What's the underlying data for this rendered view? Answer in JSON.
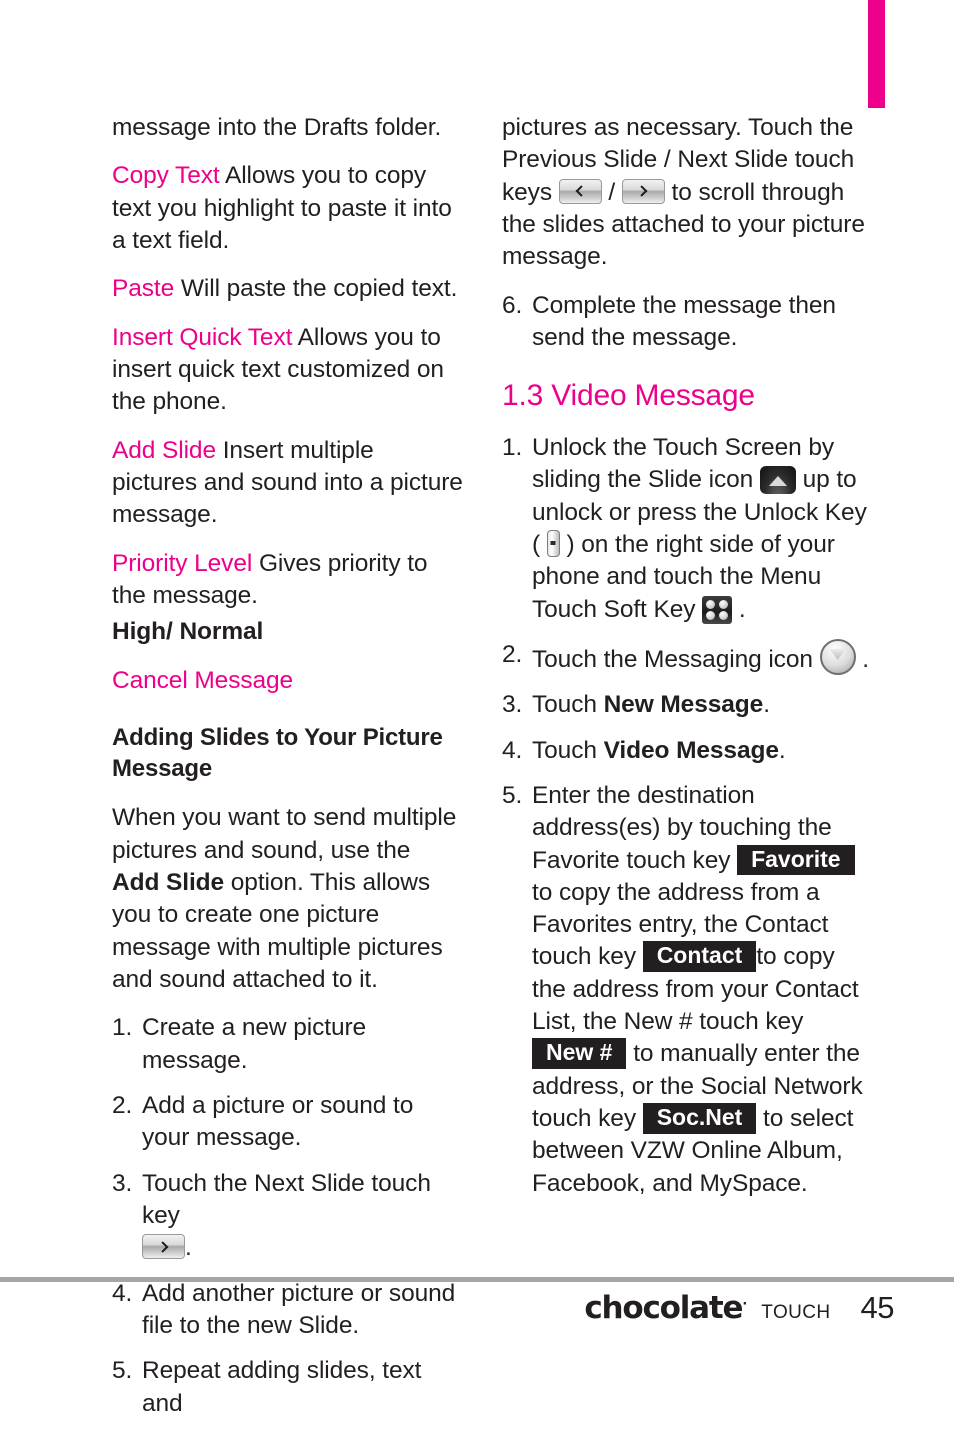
{
  "theme": {
    "accent_pink": "#ec008c",
    "text": "#231f20",
    "key_black": "#231f20",
    "rule_gray": "#a6a6a6"
  },
  "edge_tab": {
    "name": "chapter-tab",
    "color": "#ec008c"
  },
  "left_column": {
    "continued_paragraph": "message into the Drafts folder.",
    "options": [
      {
        "term": "Copy Text",
        "desc": "Allows you to copy text you highlight to paste it into a text field."
      },
      {
        "term": "Paste",
        "desc": "Will paste the copied text."
      },
      {
        "term": "Insert Quick Text",
        "desc": "Allows you to insert quick text customized on the phone."
      },
      {
        "term": "Add Slide",
        "desc": "Insert multiple pictures and sound into a picture message."
      },
      {
        "term": "Priority Level",
        "desc": "Gives priority to the message."
      }
    ],
    "priority_values": "High/ Normal",
    "cancel_option": "Cancel Message",
    "subheading": "Adding Slides to Your Picture Message",
    "intro": {
      "part1": "When you want to send multiple pictures and sound, use the ",
      "bold1": "Add Slide",
      "part2": " option. This allows you to create one picture message with multiple pictures and sound attached to it."
    },
    "steps": [
      {
        "num": "1.",
        "text": "Create a new picture message."
      },
      {
        "num": "2.",
        "text": "Add a picture or sound to your message."
      },
      {
        "num": "3.",
        "text_before": "Touch the Next Slide touch key ",
        "icon": "next-slide-key-icon",
        "text_after": "."
      },
      {
        "num": "4.",
        "text": "Add another picture or sound file to the new Slide."
      },
      {
        "num": "5.",
        "text": "Repeat adding slides, text and"
      }
    ]
  },
  "right_column": {
    "continued_step": {
      "part1": "pictures as necessary. Touch the Previous Slide / Next Slide touch keys ",
      "icon_prev": "previous-slide-key-icon",
      "separator": " / ",
      "icon_next": "next-slide-key-icon",
      "part2": " to scroll through the slides attached to your picture message."
    },
    "step6": {
      "num": "6.",
      "text": "Complete the message then send the message."
    },
    "section_heading": "1.3 Video Message",
    "steps": [
      {
        "num": "1.",
        "part1": "Unlock the Touch Screen by sliding the Slide icon ",
        "icon_slide": "slide-unlock-icon",
        "part2": " up to unlock or press the Unlock Key ( ",
        "icon_unlock": "unlock-key-icon",
        "part3": " ) on the right side of your phone and touch the Menu Touch Soft Key ",
        "icon_menu": "menu-soft-key-icon",
        "part4": " ."
      },
      {
        "num": "2.",
        "part1": "Touch the Messaging icon ",
        "icon_messaging": "messaging-icon",
        "part2": " ."
      },
      {
        "num": "3.",
        "part1": "Touch ",
        "bold": "New Message",
        "part2": "."
      },
      {
        "num": "4.",
        "part1": "Touch ",
        "bold": "Video Message",
        "part2": "."
      },
      {
        "num": "5.",
        "p1": "Enter the destination address(es) by touching the Favorite touch key ",
        "key1": "Favorite",
        "p2": " to copy the address from a Favorites entry, the Contact touch key ",
        "key2": "Contact",
        "p3": "to copy the address from your Contact List, the New # touch key ",
        "key3": "New #",
        "p4": " to manually enter the address, or the Social Network touch key ",
        "key4": "Soc.Net",
        "p5": " to select between VZW Online Album, Facebook, and MySpace."
      }
    ]
  },
  "footer": {
    "brand": "chocolate",
    "brand_mark": "·",
    "brand_sub": "TOUCH",
    "page_number": "45"
  }
}
